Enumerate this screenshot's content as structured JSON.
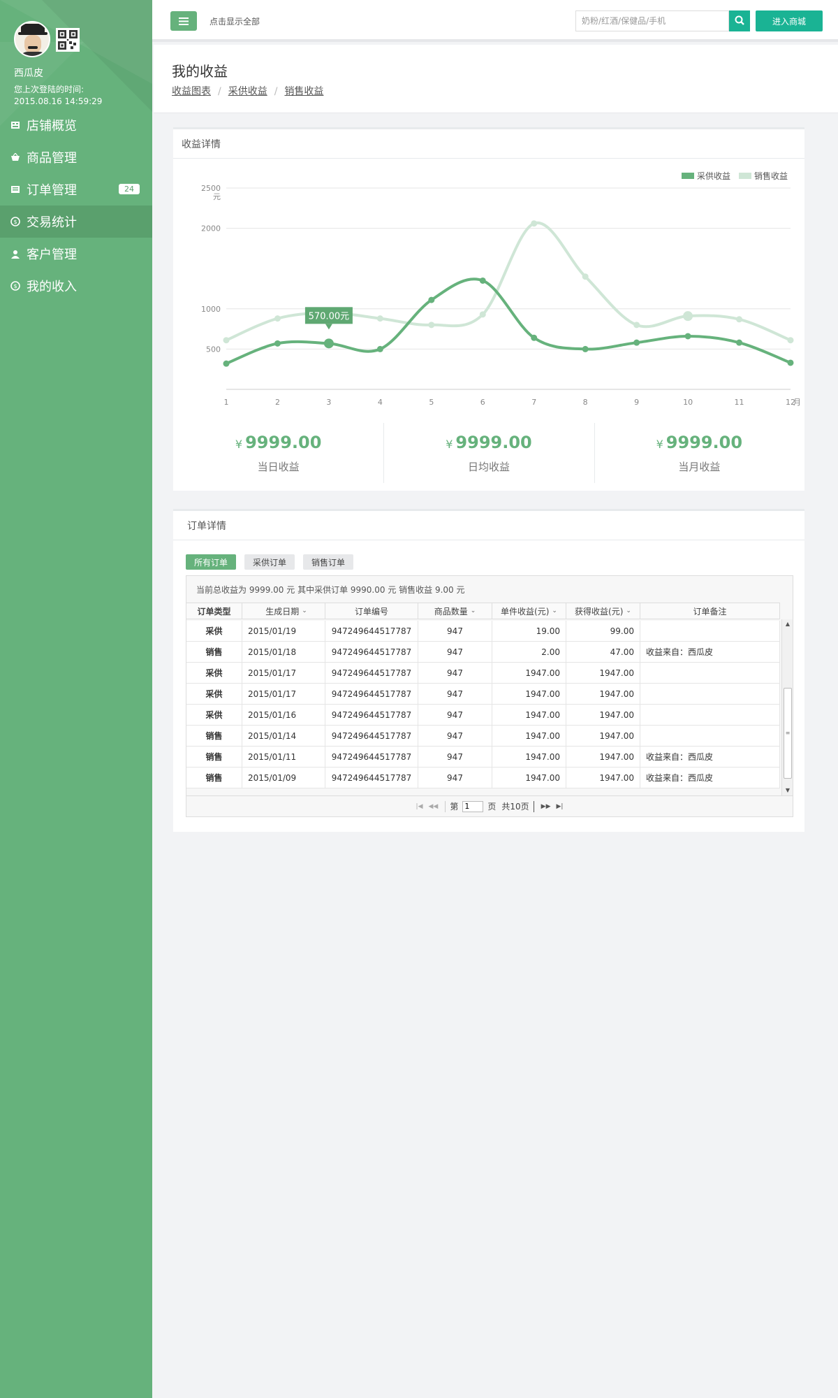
{
  "sidebar": {
    "user_name": "西瓜皮",
    "last_login_label": "您上次登陆的时间:",
    "last_login_time": "2015.08.16 14:59:29",
    "items": [
      {
        "label": "店铺概览",
        "icon": "store-icon"
      },
      {
        "label": "商品管理",
        "icon": "basket-icon"
      },
      {
        "label": "订单管理",
        "icon": "list-icon",
        "badge": "24"
      },
      {
        "label": "交易统计",
        "icon": "coin-icon",
        "active": true
      },
      {
        "label": "客户管理",
        "icon": "user-icon"
      },
      {
        "label": "我的收入",
        "icon": "coin-icon"
      }
    ]
  },
  "topbar": {
    "show_all": "点击显示全部",
    "search_placeholder": "奶粉/红酒/保健品/手机",
    "mall_button": "进入商城"
  },
  "page": {
    "title": "我的收益",
    "breadcrumb": [
      "收益图表",
      "采供收益",
      "销售收益"
    ]
  },
  "income_panel": {
    "title": "收益详情",
    "stats": [
      {
        "currency": "¥",
        "amount": "9999.00",
        "label": "当日收益"
      },
      {
        "currency": "¥",
        "amount": "9999.00",
        "label": "日均收益"
      },
      {
        "currency": "¥",
        "amount": "9999.00",
        "label": "当月收益"
      }
    ]
  },
  "chart_data": {
    "type": "line",
    "x": [
      1,
      2,
      3,
      4,
      5,
      6,
      7,
      8,
      9,
      10,
      11,
      12
    ],
    "xlabel": "月",
    "ylabel": "元",
    "yticks": [
      500,
      1000,
      2000,
      2500
    ],
    "ylim": [
      0,
      2500
    ],
    "grid": true,
    "legend": "top-right",
    "series": [
      {
        "name": "采供收益",
        "color": "#66b27c",
        "values": [
          320,
          570,
          570,
          500,
          1110,
          1350,
          640,
          500,
          580,
          660,
          580,
          330
        ]
      },
      {
        "name": "销售收益",
        "color": "#cfe6d6",
        "values": [
          610,
          880,
          950,
          880,
          800,
          930,
          2060,
          1400,
          800,
          910,
          870,
          610
        ]
      }
    ],
    "tooltip": {
      "x": 3,
      "text": "570.00元"
    }
  },
  "orders_panel": {
    "title": "订单详情",
    "tabs": [
      "所有订单",
      "采供订单",
      "销售订单"
    ],
    "summary": "当前总收益为 9999.00 元  其中采供订单 9990.00 元   销售收益 9.00 元",
    "columns": [
      "订单类型",
      "生成日期",
      "订单编号",
      "商品数量",
      "单件收益(元)",
      "获得收益(元)",
      "订单备注"
    ],
    "rows": [
      [
        "采供",
        "2015/01/19",
        "947249644517787",
        "947",
        "19.00",
        "99.00",
        ""
      ],
      [
        "销售",
        "2015/01/18",
        "947249644517787",
        "947",
        "2.00",
        "47.00",
        "收益来自：西瓜皮"
      ],
      [
        "采供",
        "2015/01/17",
        "947249644517787",
        "947",
        "1947.00",
        "1947.00",
        ""
      ],
      [
        "采供",
        "2015/01/17",
        "947249644517787",
        "947",
        "1947.00",
        "1947.00",
        ""
      ],
      [
        "采供",
        "2015/01/16",
        "947249644517787",
        "947",
        "1947.00",
        "1947.00",
        ""
      ],
      [
        "销售",
        "2015/01/14",
        "947249644517787",
        "947",
        "1947.00",
        "1947.00",
        ""
      ],
      [
        "销售",
        "2015/01/11",
        "947249644517787",
        "947",
        "1947.00",
        "1947.00",
        "收益来自：西瓜皮"
      ],
      [
        "销售",
        "2015/01/09",
        "947249644517787",
        "947",
        "1947.00",
        "1947.00",
        "收益来自：西瓜皮"
      ]
    ],
    "pager": {
      "page_prefix": "第",
      "page_value": "1",
      "page_suffix": "页",
      "total": "共10页"
    }
  }
}
